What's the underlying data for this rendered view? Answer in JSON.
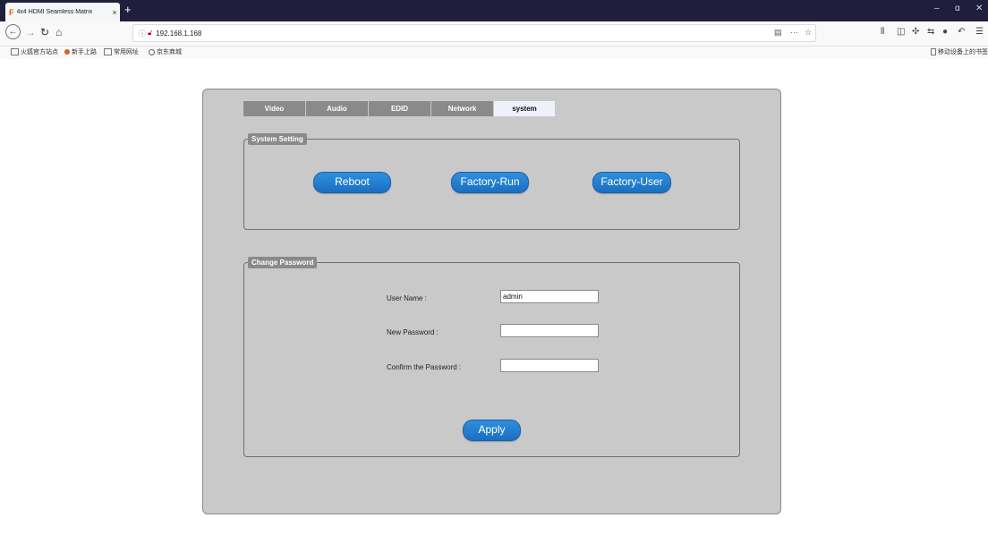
{
  "browser": {
    "tab_title": "4x4 HDMI Seamless Matrix",
    "tab_close": "×",
    "new_tab": "+",
    "url": "192.168.1.168",
    "win_min": "–",
    "win_max": "ɑ",
    "win_close": "✕"
  },
  "bookmarks": {
    "items": [
      "火狐官方站点",
      "新手上路",
      "常用网址",
      "京东商城"
    ],
    "mobile": "移动设备上的书签"
  },
  "tabs": [
    {
      "label": "Video",
      "active": false
    },
    {
      "label": "Audio",
      "active": false
    },
    {
      "label": "EDID",
      "active": false
    },
    {
      "label": "Network",
      "active": false
    },
    {
      "label": "system",
      "active": true
    }
  ],
  "system_setting": {
    "legend": "System Setting",
    "buttons": [
      "Reboot",
      "Factory-Run",
      "Factory-User"
    ]
  },
  "change_password": {
    "legend": "Change Password",
    "user_name_label": "User Name :",
    "user_name_value": "admin",
    "new_password_label": "New Password :",
    "new_password_value": "",
    "confirm_label": "Confirm the Password :",
    "confirm_value": "",
    "apply_label": "Apply"
  },
  "colors": {
    "accent_button": "#1b6fc2",
    "tab_inactive": "#8a8a8a",
    "tab_active": "#eef1fa",
    "panel_bg": "#c9c9c9",
    "titlebar": "#1f1f3d"
  }
}
